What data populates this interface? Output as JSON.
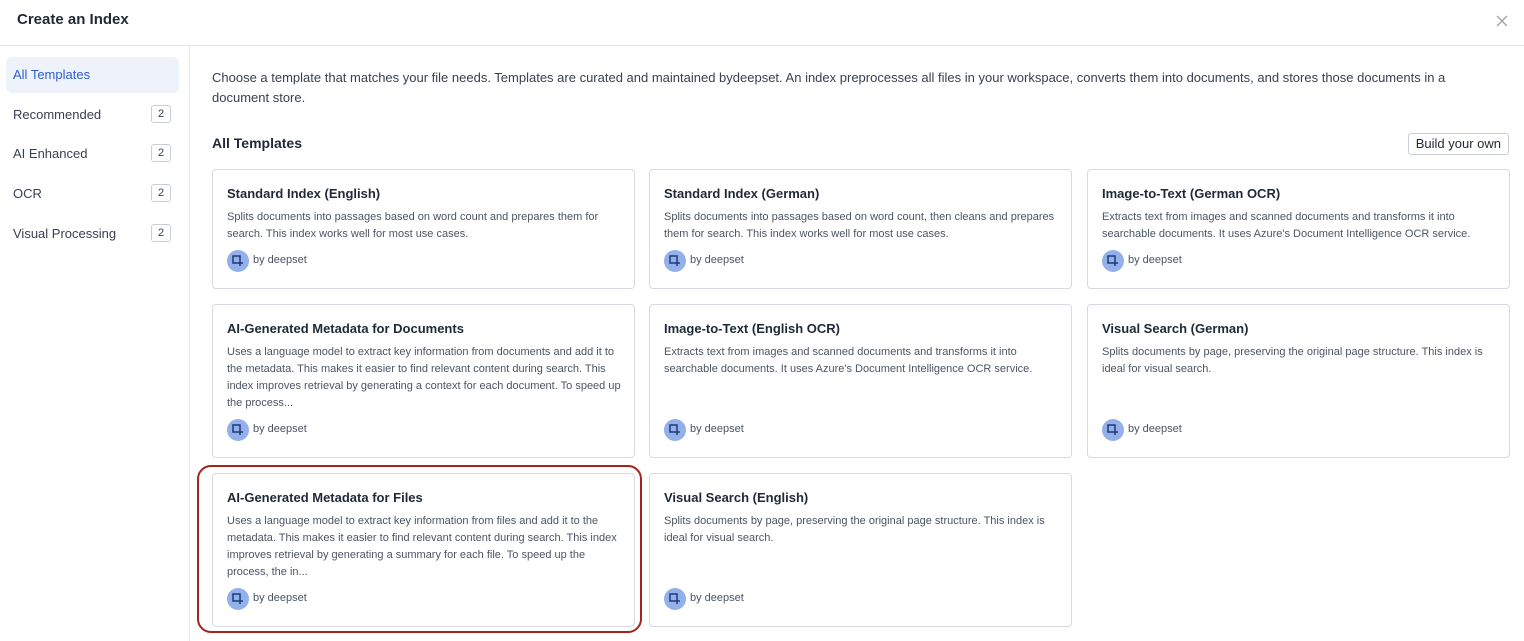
{
  "dialog": {
    "title": "Create an Index"
  },
  "icons": {
    "close": "close-icon",
    "avatar": "deepset-logo-icon"
  },
  "sidebar": {
    "items": [
      {
        "label": "All Templates",
        "count": "",
        "active": true
      },
      {
        "label": "Recommended",
        "count": "2",
        "active": false
      },
      {
        "label": "AI Enhanced",
        "count": "2",
        "active": false
      },
      {
        "label": "OCR",
        "count": "2",
        "active": false
      },
      {
        "label": "Visual Processing",
        "count": "2",
        "active": false
      }
    ]
  },
  "main": {
    "intro": "Choose a template that matches your file needs. Templates are curated and maintained bydeepset. An index preprocesses all files in your workspace, converts them into documents, and stores those documents in a document store.",
    "section_title": "All Templates",
    "build_button": "Build your own"
  },
  "cards": [
    {
      "title": "Standard Index (English)",
      "description": "Splits documents into passages based on word count and prepares them for search. This index works well for most use cases.",
      "author": "by deepset"
    },
    {
      "title": "Standard Index (German)",
      "description": "Splits documents into passages based on word count, then cleans and prepares them for search. This index works well for most use cases.",
      "author": "by deepset"
    },
    {
      "title": "Image-to-Text (German OCR)",
      "description": "Extracts text from images and scanned documents and transforms it into searchable documents. It uses Azure's Document Intelligence OCR service.",
      "author": "by deepset"
    },
    {
      "title": "AI-Generated Metadata for Documents",
      "description": "Uses a language model to extract key information from documents and add it to the metadata. This makes it easier to find relevant content during search. This index improves retrieval by generating a context for each document. To speed up the process...",
      "author": "by deepset"
    },
    {
      "title": "Image-to-Text (English OCR)",
      "description": "Extracts text from images and scanned documents and transforms it into searchable documents. It uses Azure's Document Intelligence OCR service.",
      "author": "by deepset"
    },
    {
      "title": "Visual Search (German)",
      "description": "Splits documents by page, preserving the original page structure. This index is ideal for visual search.",
      "author": "by deepset"
    },
    {
      "title": "AI-Generated Metadata for Files",
      "description": "Uses a language model to extract key information from files and add it to the metadata. This makes it easier to find relevant content during search. This index improves retrieval by generating a summary for each file. To speed up the process, the in...",
      "author": "by deepset"
    },
    {
      "title": "Visual Search (English)",
      "description": "Splits documents by page, preserving the original page structure. This index is ideal for visual search.",
      "author": "by deepset"
    }
  ],
  "colors": {
    "accent": "#2f5fd0",
    "active_bg": "#eef2fb",
    "highlight": "#a3241b",
    "avatar": "#93b0ea"
  }
}
